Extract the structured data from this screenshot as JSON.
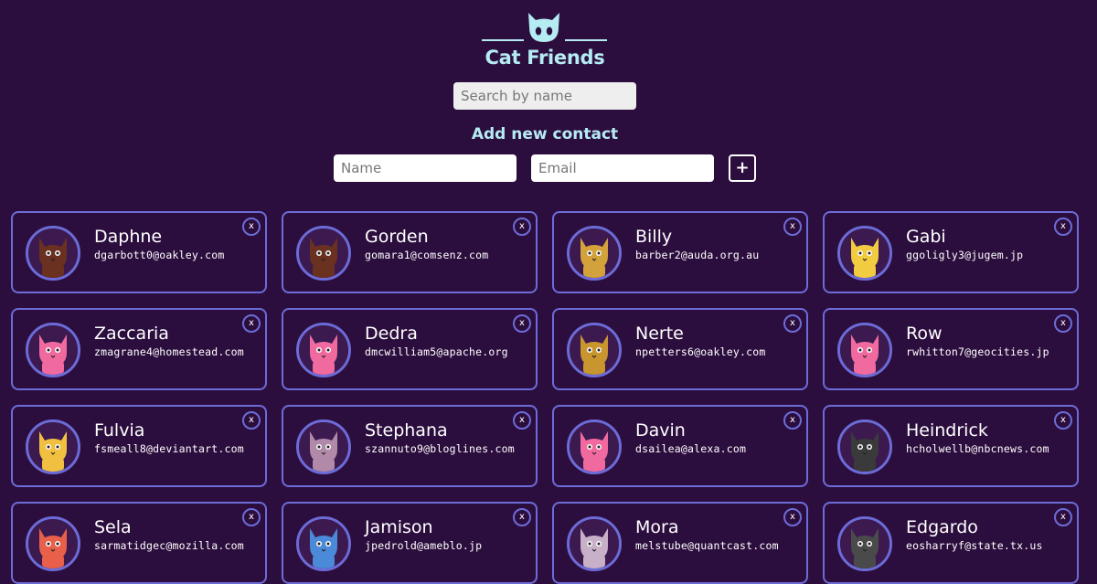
{
  "app": {
    "title": "Cat Friends",
    "logo_icon": "cat-icon",
    "accent_color": "#b5ebf3",
    "background_color": "#2c0e3e",
    "card_border_color": "#6c6cd8"
  },
  "search": {
    "placeholder": "Search by name",
    "value": ""
  },
  "add_contact": {
    "heading": "Add new contact",
    "name_placeholder": "Name",
    "email_placeholder": "Email",
    "add_label": "+"
  },
  "contacts": [
    {
      "name": "Daphne",
      "email": "dgarbott0@oakley.com",
      "delete_label": "x",
      "avatar_color": "#6a3020"
    },
    {
      "name": "Gorden",
      "email": "gomara1@comsenz.com",
      "delete_label": "x",
      "avatar_color": "#6a3020"
    },
    {
      "name": "Billy",
      "email": "barber2@auda.org.au",
      "delete_label": "x",
      "avatar_color": "#d4a23a"
    },
    {
      "name": "Gabi",
      "email": "ggoligly3@jugem.jp",
      "delete_label": "x",
      "avatar_color": "#f2cc40"
    },
    {
      "name": "Zaccaria",
      "email": "zmagrane4@homestead.com",
      "delete_label": "x",
      "avatar_color": "#f06aa0"
    },
    {
      "name": "Dedra",
      "email": "dmcwilliam5@apache.org",
      "delete_label": "x",
      "avatar_color": "#f06aa0"
    },
    {
      "name": "Nerte",
      "email": "npetters6@oakley.com",
      "delete_label": "x",
      "avatar_color": "#c8952e"
    },
    {
      "name": "Row",
      "email": "rwhitton7@geocities.jp",
      "delete_label": "x",
      "avatar_color": "#f06aa0"
    },
    {
      "name": "Fulvia",
      "email": "fsmeall8@deviantart.com",
      "delete_label": "x",
      "avatar_color": "#f2c040"
    },
    {
      "name": "Stephana",
      "email": "szannuto9@bloglines.com",
      "delete_label": "x",
      "avatar_color": "#b08aa8"
    },
    {
      "name": "Davin",
      "email": "dsailea@alexa.com",
      "delete_label": "x",
      "avatar_color": "#f06aa0"
    },
    {
      "name": "Heindrick",
      "email": "hcholwellb@nbcnews.com",
      "delete_label": "x",
      "avatar_color": "#3a3a3a"
    },
    {
      "name": "Sela",
      "email": "sarmatidgec@mozilla.com",
      "delete_label": "x",
      "avatar_color": "#e8604a"
    },
    {
      "name": "Jamison",
      "email": "jpedrold@ameblo.jp",
      "delete_label": "x",
      "avatar_color": "#4a8ad8"
    },
    {
      "name": "Mora",
      "email": "melstube@quantcast.com",
      "delete_label": "x",
      "avatar_color": "#c8b0c8"
    },
    {
      "name": "Edgardo",
      "email": "eosharryf@state.tx.us",
      "delete_label": "x",
      "avatar_color": "#4a4a4a"
    }
  ]
}
